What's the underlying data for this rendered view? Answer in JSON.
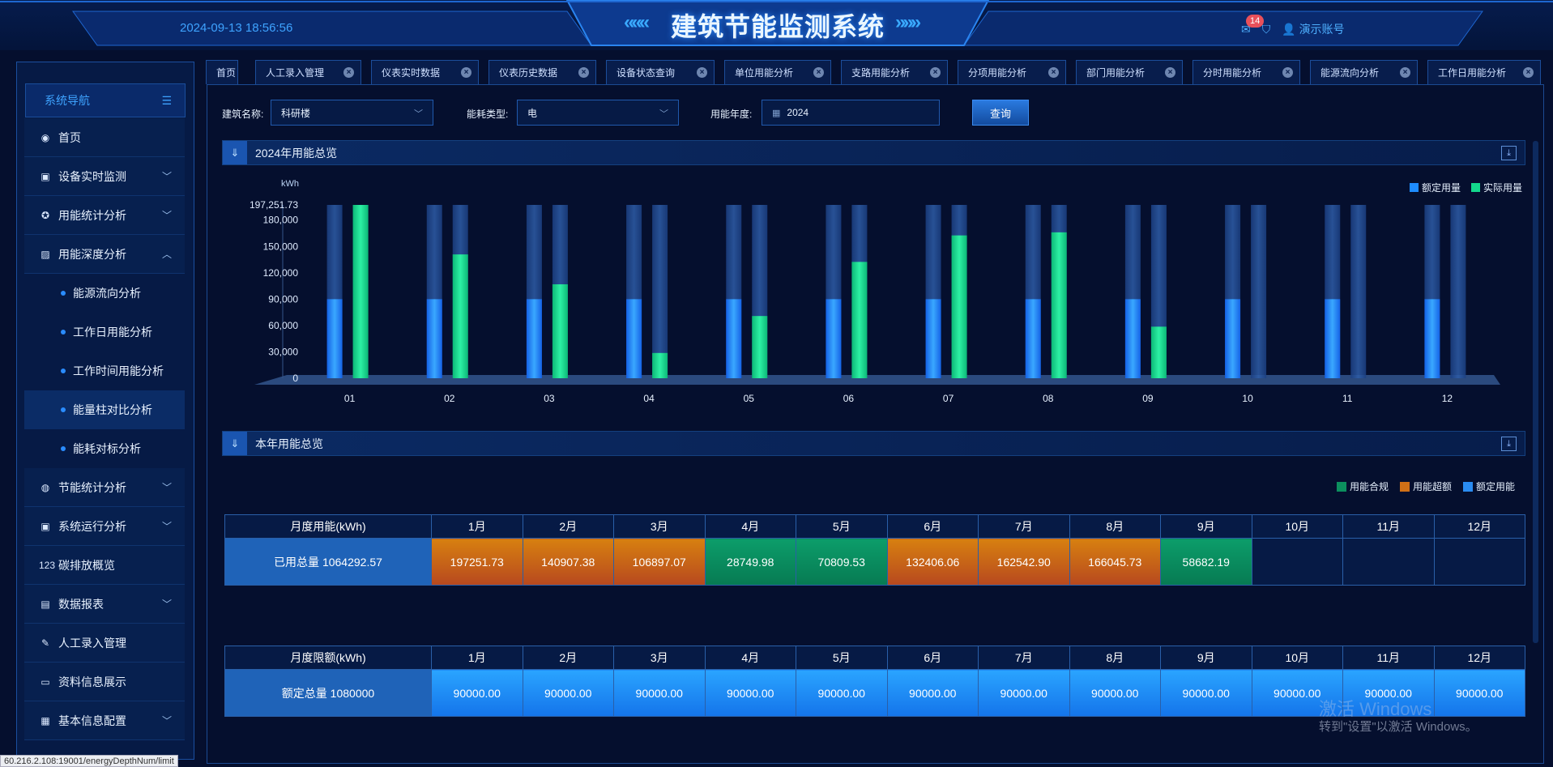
{
  "header": {
    "datetime": "2024-09-13 18:56:56",
    "title": "建筑节能监测系统",
    "title_left_chevrons": "«««",
    "title_right_chevrons": "»»»",
    "notification_count": "14",
    "account": "演示账号"
  },
  "sidebar": {
    "title": "系统导航",
    "items": [
      {
        "label": "首页",
        "icon": "dashboard-icon",
        "glyph": "◉",
        "expandable": false
      },
      {
        "label": "设备实时监测",
        "icon": "monitor-icon",
        "glyph": "▣",
        "expandable": true,
        "expanded": false
      },
      {
        "label": "用能统计分析",
        "icon": "target-icon",
        "glyph": "✪",
        "expandable": true,
        "expanded": false
      },
      {
        "label": "用能深度分析",
        "icon": "image-icon",
        "glyph": "▨",
        "expandable": true,
        "expanded": true
      }
    ],
    "subitems": [
      {
        "label": "能源流向分析",
        "active": false
      },
      {
        "label": "工作日用能分析",
        "active": false
      },
      {
        "label": "工作时间用能分析",
        "active": false
      },
      {
        "label": "能量柱对比分析",
        "active": true
      },
      {
        "label": "能耗对标分析",
        "active": false
      }
    ],
    "items_after": [
      {
        "label": "节能统计分析",
        "icon": "globe-icon",
        "glyph": "◍",
        "expandable": true
      },
      {
        "label": "系统运行分析",
        "icon": "monitor-chart-icon",
        "glyph": "▣",
        "expandable": true
      },
      {
        "label": "碳排放概览",
        "icon": "numbers-icon",
        "glyph": "123",
        "expandable": false
      },
      {
        "label": "数据报表",
        "icon": "report-icon",
        "glyph": "▤",
        "expandable": true
      },
      {
        "label": "人工录入管理",
        "icon": "edit-icon",
        "glyph": "✎",
        "expandable": false
      },
      {
        "label": "资料信息展示",
        "icon": "card-icon",
        "glyph": "▭",
        "expandable": false
      },
      {
        "label": "基本信息配置",
        "icon": "config-icon",
        "glyph": "▦",
        "expandable": true
      }
    ]
  },
  "tabs": [
    "首页",
    "人工录入管理",
    "仪表实时数据",
    "仪表历史数据",
    "设备状态查询",
    "单位用能分析",
    "支路用能分析",
    "分项用能分析",
    "部门用能分析",
    "分时用能分析",
    "能源流向分析",
    "工作日用能分析"
  ],
  "filters": {
    "building_label": "建筑名称:",
    "building_value": "科研楼",
    "energy_label": "能耗类型:",
    "energy_value": "电",
    "year_label": "用能年度:",
    "year_value": "2024",
    "query_button": "查询"
  },
  "section1": {
    "title": "2024年用能总览"
  },
  "section2": {
    "title": "本年用能总览"
  },
  "chart_data": {
    "type": "bar",
    "title": "2024年用能总览",
    "unit": "kWh",
    "categories": [
      "01",
      "02",
      "03",
      "04",
      "05",
      "06",
      "07",
      "08",
      "09",
      "10",
      "11",
      "12"
    ],
    "series": [
      {
        "name": "额定用量",
        "color": "#1e8cff",
        "values": [
          90000,
          90000,
          90000,
          90000,
          90000,
          90000,
          90000,
          90000,
          90000,
          90000,
          90000,
          90000
        ]
      },
      {
        "name": "实际用量",
        "color": "#13d98c",
        "values": [
          197251.73,
          140907.38,
          106897.07,
          28749.98,
          70809.53,
          132406.06,
          162542.9,
          166045.73,
          58682.19,
          0,
          0,
          0
        ]
      }
    ],
    "ylim": [
      0,
      197251.73
    ],
    "yticks": [
      "197,251.73",
      "180,000",
      "150,000",
      "120,000",
      "90,000",
      "60,000",
      "30,000",
      "0"
    ],
    "ytick_values": [
      197251.73,
      180000,
      150000,
      120000,
      90000,
      60000,
      30000,
      0
    ],
    "legend": "top-right"
  },
  "legend2": [
    {
      "label": "用能合规",
      "color": "#0c8f5e"
    },
    {
      "label": "用能超额",
      "color": "#d07016"
    },
    {
      "label": "额定用能",
      "color": "#2a8cf2"
    }
  ],
  "usage_table": {
    "header": "月度用能(kWh)",
    "months": [
      "1月",
      "2月",
      "3月",
      "4月",
      "5月",
      "6月",
      "7月",
      "8月",
      "9月",
      "10月",
      "11月",
      "12月"
    ],
    "row_label": "已用总量  1064292.57",
    "values": [
      "197251.73",
      "140907.38",
      "106897.07",
      "28749.98",
      "70809.53",
      "132406.06",
      "162542.90",
      "166045.73",
      "58682.19",
      "",
      "",
      ""
    ],
    "status": [
      "over",
      "over",
      "over",
      "ok",
      "ok",
      "over",
      "over",
      "over",
      "ok",
      "empty",
      "empty",
      "empty"
    ]
  },
  "quota_table": {
    "header": "月度限额(kWh)",
    "months": [
      "1月",
      "2月",
      "3月",
      "4月",
      "5月",
      "6月",
      "7月",
      "8月",
      "9月",
      "10月",
      "11月",
      "12月"
    ],
    "row_label": "额定总量  1080000",
    "values": [
      "90000.00",
      "90000.00",
      "90000.00",
      "90000.00",
      "90000.00",
      "90000.00",
      "90000.00",
      "90000.00",
      "90000.00",
      "90000.00",
      "90000.00",
      "90000.00"
    ]
  },
  "watermark": {
    "line1": "激活 Windows",
    "line2": "转到\"设置\"以激活 Windows。"
  },
  "status_url": "60.216.2.108:19001/energyDepthNum/limit"
}
